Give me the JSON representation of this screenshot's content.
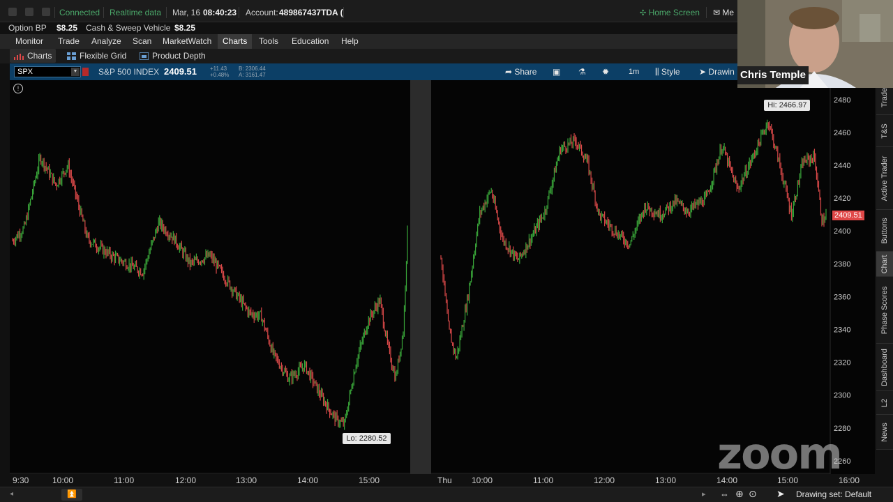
{
  "status_bar": {
    "connected": "Connected",
    "realtime": "Realtime data",
    "date": "Mar, 16",
    "time": "08:40:23",
    "account_label": "Account:",
    "account_value": "489867437TDA (",
    "home_screen": "Home Screen",
    "messages": "Me"
  },
  "balances": {
    "option_bp_label": "Option BP",
    "option_bp_value": "$8.25",
    "cash_label": "Cash & Sweep Vehicle",
    "cash_value": "$8.25"
  },
  "menu": {
    "items": [
      "Monitor",
      "Trade",
      "Analyze",
      "Scan",
      "MarketWatch",
      "Charts",
      "Tools",
      "Education",
      "Help"
    ],
    "active": "Charts"
  },
  "subtabs": {
    "charts": "Charts",
    "flexible_grid": "Flexible Grid",
    "product_depth": "Product Depth"
  },
  "chart_header": {
    "symbol": "SPX",
    "name": "S&P 500 INDEX",
    "last": "2409.51",
    "change": "+11.43",
    "change_pct": "+0.48%",
    "bid": "B: 2306.44",
    "ask": "A: 3161.47",
    "share": "Share",
    "interval": "1m",
    "style": "Style",
    "drawings": "Drawin"
  },
  "video": {
    "presenter": "Chris Temple",
    "watermark": "zoom"
  },
  "right_tabs": [
    "Trade",
    "T&S",
    "Active Trader",
    "Buttons",
    "Chart",
    "Phase Scores",
    "Dashboard",
    "L2",
    "News"
  ],
  "right_tabs_active": "Chart",
  "bottom_bar": {
    "drawing_set": "Drawing set: Default"
  },
  "colors": {
    "up": "#3aa83a",
    "down": "#d84848",
    "background": "#050505",
    "header_blue": "#0c3f66",
    "current_price": "#e04848"
  },
  "chart_data": {
    "type": "candlestick",
    "symbol": "SPX",
    "interval": "1m",
    "y_ticks": [
      2260,
      2280,
      2300,
      2320,
      2340,
      2360,
      2380,
      2400,
      2420,
      2440,
      2460,
      2480
    ],
    "ylim": [
      2257,
      2485
    ],
    "x_ticks_day1": [
      "9:30",
      "10:00",
      "11:00",
      "12:00",
      "13:00",
      "14:00",
      "15:00"
    ],
    "x_ticks_day2": [
      "Thu",
      "10:00",
      "11:00",
      "12:00",
      "13:00",
      "14:00",
      "15:00",
      "16:00"
    ],
    "high_label": "Hi: 2466.97",
    "low_label": "Lo: 2280.52",
    "current_price": "2409.51",
    "high": 2466.97,
    "low": 2280.52,
    "last": 2409.51,
    "day1_path": [
      [
        0,
        2394
      ],
      [
        0.03,
        2402
      ],
      [
        0.07,
        2445
      ],
      [
        0.11,
        2428
      ],
      [
        0.14,
        2440
      ],
      [
        0.19,
        2395
      ],
      [
        0.25,
        2385
      ],
      [
        0.33,
        2375
      ],
      [
        0.37,
        2405
      ],
      [
        0.41,
        2395
      ],
      [
        0.45,
        2380
      ],
      [
        0.5,
        2385
      ],
      [
        0.57,
        2360
      ],
      [
        0.6,
        2350
      ],
      [
        0.63,
        2348
      ],
      [
        0.66,
        2325
      ],
      [
        0.7,
        2310
      ],
      [
        0.74,
        2318
      ],
      [
        0.78,
        2300
      ],
      [
        0.8,
        2292
      ],
      [
        0.82,
        2285
      ],
      [
        0.84,
        2282
      ],
      [
        0.87,
        2320
      ],
      [
        0.9,
        2345
      ],
      [
        0.93,
        2358
      ],
      [
        0.95,
        2330
      ],
      [
        0.97,
        2310
      ],
      [
        0.99,
        2340
      ],
      [
        1.0,
        2400
      ]
    ],
    "day2_path": [
      [
        0,
        2385
      ],
      [
        0.02,
        2340
      ],
      [
        0.04,
        2322
      ],
      [
        0.07,
        2360
      ],
      [
        0.1,
        2410
      ],
      [
        0.13,
        2425
      ],
      [
        0.16,
        2395
      ],
      [
        0.2,
        2382
      ],
      [
        0.24,
        2398
      ],
      [
        0.27,
        2412
      ],
      [
        0.31,
        2450
      ],
      [
        0.35,
        2455
      ],
      [
        0.38,
        2442
      ],
      [
        0.41,
        2410
      ],
      [
        0.46,
        2398
      ],
      [
        0.49,
        2392
      ],
      [
        0.53,
        2415
      ],
      [
        0.57,
        2410
      ],
      [
        0.61,
        2418
      ],
      [
        0.64,
        2412
      ],
      [
        0.69,
        2420
      ],
      [
        0.73,
        2452
      ],
      [
        0.77,
        2425
      ],
      [
        0.81,
        2445
      ],
      [
        0.85,
        2467
      ],
      [
        0.88,
        2440
      ],
      [
        0.91,
        2410
      ],
      [
        0.94,
        2442
      ],
      [
        0.97,
        2445
      ],
      [
        0.99,
        2405
      ],
      [
        1.0,
        2409.51
      ]
    ]
  }
}
